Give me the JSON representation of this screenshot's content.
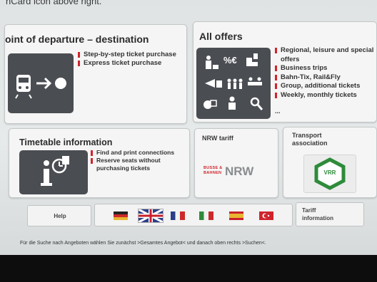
{
  "header": {
    "top_text": "nCard icon above right."
  },
  "departure": {
    "title": "oint of departure – destination",
    "items": [
      "Step-by-step ticket purchase",
      "Express ticket purchase"
    ]
  },
  "offers": {
    "title": "All offers",
    "items": [
      "Regional, leisure and special offers",
      "Business trips",
      "Bahn-Tix, Rail&Fly",
      "Group, additional tickets",
      "Weekly, monthly tickets"
    ],
    "more": "...",
    "percent_glyph": "%€"
  },
  "timetable": {
    "title": "Timetable information",
    "items": [
      "Find and print connections",
      "Reserve seats without purchasing tickets"
    ]
  },
  "nrw": {
    "title": "NRW tariff",
    "logo_line1": "BUSSE &",
    "logo_line2": "BAHNEN",
    "logo_big": "NRW"
  },
  "transport": {
    "title_line1": "Transport",
    "title_line2": "association",
    "vrr": "VRR"
  },
  "buttons": {
    "help": "Help",
    "tariff_line1": "Tariff",
    "tariff_line2": "information"
  },
  "languages": [
    "German",
    "English",
    "French",
    "Italian",
    "Spanish",
    "Turkish"
  ],
  "footer": {
    "text": "Für die Suche nach Angeboten wählen Sie zunächst >Gesamtes Angebot< und danach oben rechts >Suchen<."
  },
  "colors": {
    "accent_red": "#d0242c",
    "panel_dark": "#4a4d52",
    "vrr_green": "#2e8b3a"
  }
}
